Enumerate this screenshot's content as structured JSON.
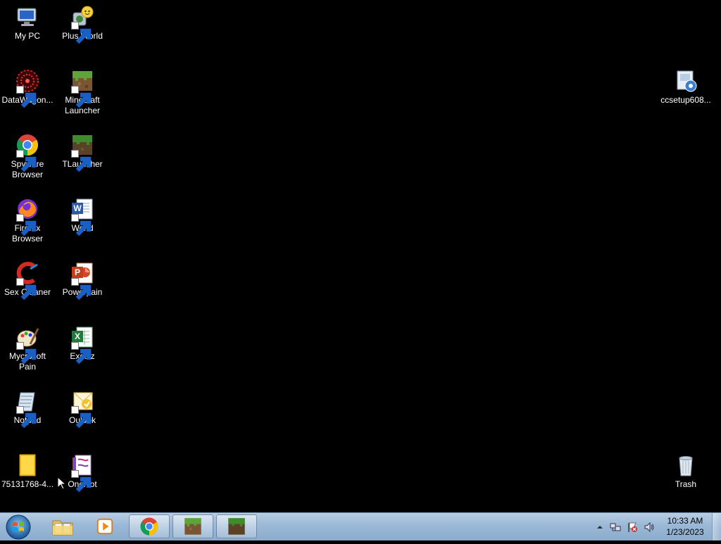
{
  "desktop": {
    "icons": {
      "my_pc": "My PC",
      "plus_world": "Plus World",
      "datawagon": "DataWagon...",
      "minecraft_launcher": "Minecraft Launcher",
      "ccsetup": "ccsetup608...",
      "spyware_browser": "Spyware Browser",
      "tlauncher": "TLauncher",
      "firefox_browser": "Firefox Browser",
      "world": "World",
      "sex_cleaner": "Sex Cleaner",
      "powerpain": "Powerpain",
      "mycrosoft_pain": "Mycrosoft Pain",
      "excelz": "Excelz",
      "notpad": "Notpad",
      "oulook": "Oulook",
      "image_file": "75131768-4...",
      "onenot": "OneNot",
      "trash": "Trash"
    }
  },
  "taskbar": {
    "pinned": [
      "start-orb",
      "file-explorer",
      "media-player",
      "chrome",
      "minecraft-launcher",
      "tlauncher"
    ],
    "clock": {
      "time": "10:33 AM",
      "date": "1/23/2023"
    }
  },
  "colors": {
    "desktop_bg": "#000000",
    "taskbar_top": "#b7cde3",
    "taskbar_bottom": "#8caccd"
  }
}
